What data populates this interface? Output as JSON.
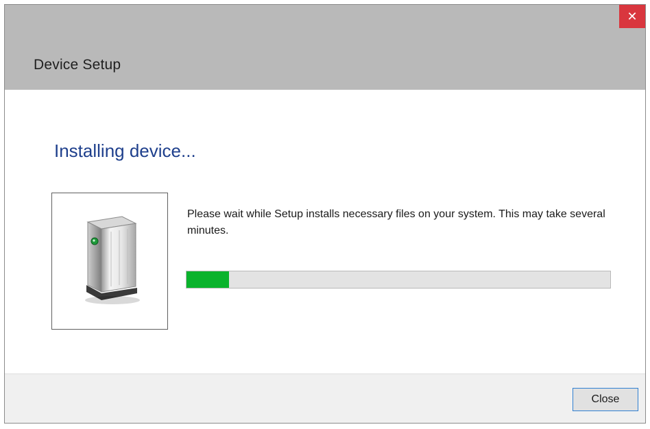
{
  "window": {
    "title": "Device Setup",
    "close_glyph": "✕"
  },
  "content": {
    "heading": "Installing device...",
    "message": "Please wait while Setup installs necessary files on your system. This may take several minutes.",
    "device_icon": "printer-device-icon",
    "progress_percent": 10,
    "progress_color": "#0ab32c",
    "heading_color": "#1e3f8c"
  },
  "footer": {
    "close_label": "Close"
  }
}
